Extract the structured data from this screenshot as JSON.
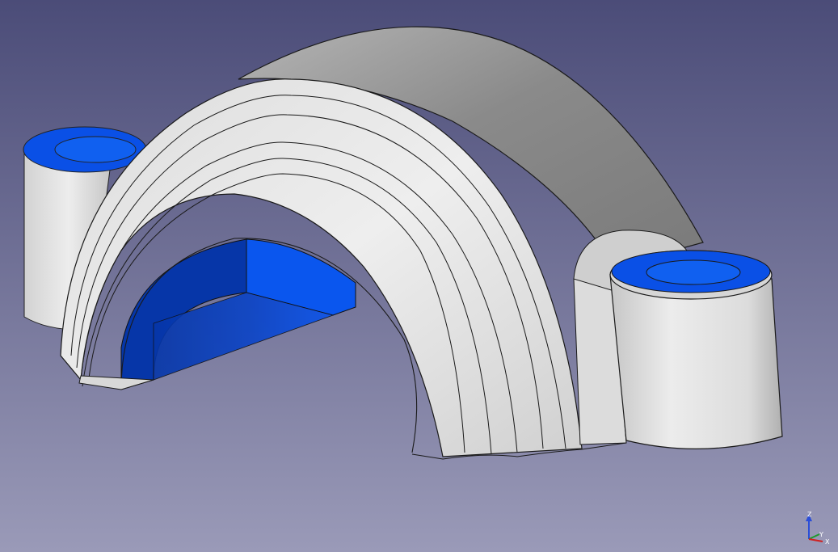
{
  "viewport": {
    "background_top": "#4b4c78",
    "background_bottom": "#9a9ab8"
  },
  "model": {
    "surface_light": "#e6e6e6",
    "surface_mid": "#c8c8c8",
    "surface_dark": "#8e8e8e",
    "selected_color": "#0a50e6",
    "selected_dark": "#0636a8",
    "edge_color": "#1a1a1a"
  },
  "axis_indicator": {
    "z_label": "Z",
    "y_label": "Y",
    "x_label": "X",
    "z_color": "#2b4ed8",
    "y_color": "#1f9a2e",
    "x_color": "#d02020"
  }
}
